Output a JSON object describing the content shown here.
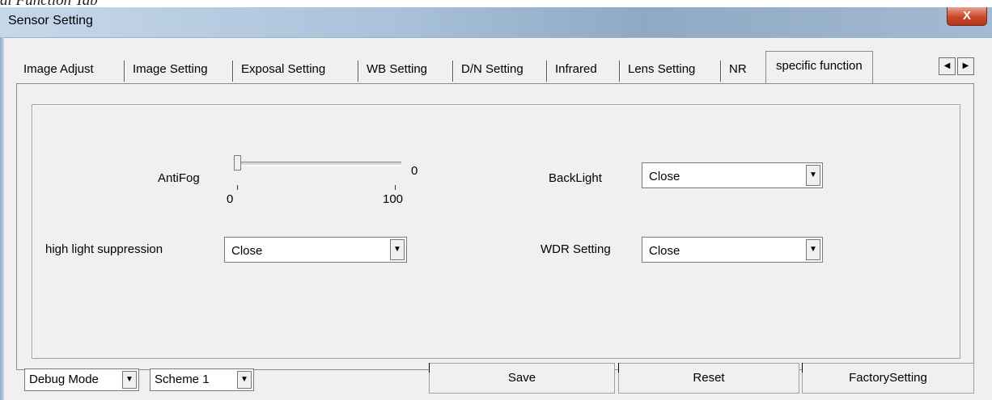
{
  "caption_fragment": "al Function Tab",
  "window": {
    "title": "Sensor Setting",
    "close_label": "X"
  },
  "tabs": [
    {
      "label": "Image Adjust"
    },
    {
      "label": "Image Setting"
    },
    {
      "label": "Exposal Setting"
    },
    {
      "label": "WB Setting"
    },
    {
      "label": "D/N Setting"
    },
    {
      "label": "Infrared"
    },
    {
      "label": "Lens Setting"
    },
    {
      "label": "NR"
    },
    {
      "label": "specific function",
      "active": true
    }
  ],
  "tab_scroll": {
    "left_icon": "◀",
    "right_icon": "▶"
  },
  "antifog": {
    "label": "AntiFog",
    "value": "0",
    "min_label": "0",
    "max_label": "100",
    "min": 0,
    "max": 100,
    "current": 0
  },
  "backlight": {
    "label": "BackLight",
    "value": "Close"
  },
  "high_light_suppression": {
    "label": "high light suppression",
    "value": "Close"
  },
  "wdr": {
    "label": "WDR Setting",
    "value": "Close"
  },
  "dropdown_icon": "▼",
  "bottom": {
    "mode_value": "Debug Mode",
    "scheme_value": "Scheme 1",
    "save_label": "Save",
    "reset_label": "Reset",
    "factory_label": "FactorySetting"
  }
}
